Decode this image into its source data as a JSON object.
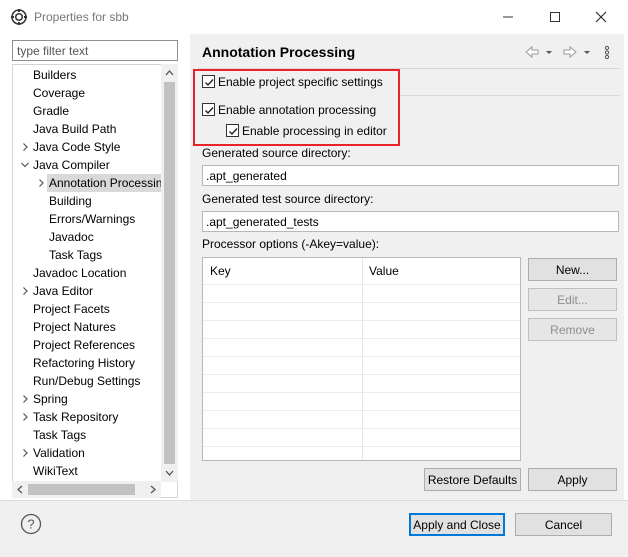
{
  "window": {
    "title": "Properties for sbb",
    "minimize_icon": "minimize-icon",
    "maximize_icon": "maximize-icon",
    "close_icon": "close-icon"
  },
  "filter": {
    "placeholder": "type filter text",
    "value": ""
  },
  "tree": {
    "items": [
      {
        "label": "Builders",
        "expandable": false,
        "depth": 0
      },
      {
        "label": "Coverage",
        "expandable": false,
        "depth": 0
      },
      {
        "label": "Gradle",
        "expandable": false,
        "depth": 0
      },
      {
        "label": "Java Build Path",
        "expandable": false,
        "depth": 0
      },
      {
        "label": "Java Code Style",
        "expandable": true,
        "expanded": false,
        "depth": 0
      },
      {
        "label": "Java Compiler",
        "expandable": true,
        "expanded": true,
        "depth": 0
      },
      {
        "label": "Annotation Processin",
        "expandable": true,
        "expanded": false,
        "depth": 1,
        "selected": true
      },
      {
        "label": "Building",
        "expandable": false,
        "depth": 1
      },
      {
        "label": "Errors/Warnings",
        "expandable": false,
        "depth": 1
      },
      {
        "label": "Javadoc",
        "expandable": false,
        "depth": 1
      },
      {
        "label": "Task Tags",
        "expandable": false,
        "depth": 1
      },
      {
        "label": "Javadoc Location",
        "expandable": false,
        "depth": 0
      },
      {
        "label": "Java Editor",
        "expandable": true,
        "expanded": false,
        "depth": 0
      },
      {
        "label": "Project Facets",
        "expandable": false,
        "depth": 0
      },
      {
        "label": "Project Natures",
        "expandable": false,
        "depth": 0
      },
      {
        "label": "Project References",
        "expandable": false,
        "depth": 0
      },
      {
        "label": "Refactoring History",
        "expandable": false,
        "depth": 0
      },
      {
        "label": "Run/Debug Settings",
        "expandable": false,
        "depth": 0
      },
      {
        "label": "Spring",
        "expandable": true,
        "expanded": false,
        "depth": 0
      },
      {
        "label": "Task Repository",
        "expandable": true,
        "expanded": false,
        "depth": 0
      },
      {
        "label": "Task Tags",
        "expandable": false,
        "depth": 0
      },
      {
        "label": "Validation",
        "expandable": true,
        "expanded": false,
        "depth": 0
      },
      {
        "label": "WikiText",
        "expandable": false,
        "depth": 0
      }
    ]
  },
  "page": {
    "title": "Annotation Processing",
    "nav_icons": [
      "back-arrow-icon",
      "dropdown-icon",
      "forward-arrow-icon",
      "dropdown-icon",
      "view-menu-icon"
    ],
    "checkboxes": {
      "project_specific": {
        "label": "Enable project specific settings",
        "checked": true
      },
      "annotation_processing": {
        "label": "Enable annotation processing",
        "checked": true
      },
      "processing_in_editor": {
        "label": "Enable processing in editor",
        "checked": true
      }
    },
    "generated_source_label": "Generated source directory:",
    "generated_source_value": ".apt_generated",
    "generated_test_label": "Generated test source directory:",
    "generated_test_value": ".apt_generated_tests",
    "processor_options_label": "Processor options (-Akey=value):",
    "table": {
      "columns": [
        "Key",
        "Value"
      ],
      "rows": []
    },
    "buttons": {
      "new": "New...",
      "edit": "Edit...",
      "remove": "Remove"
    },
    "restore_defaults": "Restore Defaults",
    "apply": "Apply"
  },
  "footer": {
    "help_icon": "help-icon",
    "apply_and_close": "Apply and Close",
    "cancel": "Cancel"
  },
  "colors": {
    "highlight": "#e8232b",
    "default_button_border": "#0078d7"
  }
}
